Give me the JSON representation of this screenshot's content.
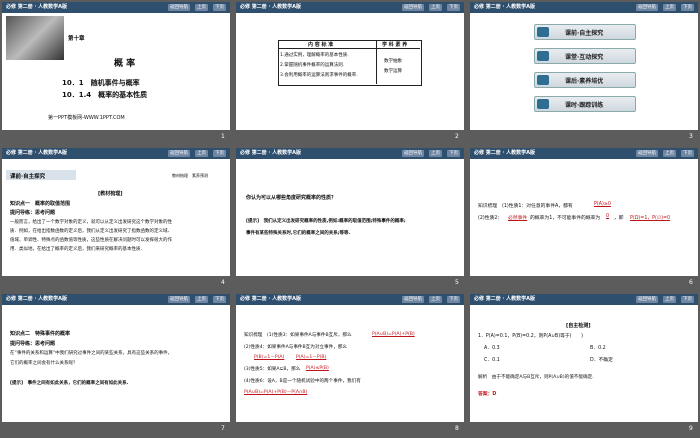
{
  "header": {
    "title": "必修 第二册 · 人教数学A版",
    "btn_nav": "返回导航",
    "btn_prev": "上页",
    "btn_next": "下页"
  },
  "page_numbers": [
    "1",
    "2",
    "3",
    "4",
    "5",
    "6",
    "7",
    "8",
    "9"
  ],
  "slide1": {
    "chapter": "第十章",
    "title": "概 率",
    "sec1": "10．1　随机事件与概率",
    "sec2": "10．1.4　概率的基本性质",
    "source": "第一PPT模板网-WWW.1PPT.COM"
  },
  "slide2": {
    "col1": "内 容 标 准",
    "col2": "学 科 素 养",
    "rows": [
      "1.通过实例，理解概率的基本性质.",
      "2.掌握随机事件概率的运算法则.",
      "3.会利用概率的运算法则求事件的概率."
    ],
    "lit": [
      "数学抽象",
      "数学运算"
    ]
  },
  "slide3": {
    "items": [
      "课前·自主探究",
      "课堂·互动探究",
      "课后·素养培优",
      "课时·跟踪训练"
    ]
  },
  "slide4": {
    "tag": "课前·自主探究",
    "right": "教材梳理　素养预测",
    "h": "[教材梳理]",
    "k1": "知识点一　概率的取值范围",
    "k2": "提问导练：思考问题",
    "p1": "一般而言，给出了一个数学对象的定义，就可以从定义出发研究这个数学对象的性",
    "p2": "质．例如，在给出指数函数的定义后，我们从定义出发研究了指数函数的定义域、",
    "p3": "值域、单调性、特殊点的函数值等性质，这些性质在解决问题时可以发挥很大的作",
    "p4": "用．类似地，在给出了概率的定义后，我们来研究概率的基本性质．"
  },
  "slide5": {
    "q": "你认为可以从哪些角度研究概率的性质？",
    "a1": "[提示]　我们从定义出发研究概率的性质,例如:概率的取值范围;特殊事件的概率;",
    "a2": "事件有某些特殊关系时,它们的概率之间的关系;等等."
  },
  "slide6": {
    "l1": "知识梳理　(1)性质1：对任意的事件A，都有",
    "f1": "P(A)≥0",
    "l2": "(2)性质2：",
    "f2": "必然事件",
    "l2b": "的概率为1，不可能事件的概率为",
    "f3": "0",
    "l2c": "，即",
    "f4": "P(Ω)=1，P(∅)=0"
  },
  "slide7": {
    "k1": "知识点二　特殊事件的概率",
    "k2": "提问导练：思考问题",
    "p1": "在“事件的关系和运算”中我们研究过事件之间的某些关系，具有这些关系的事件，",
    "p2": "它们的概率之间会有什么关系呢？",
    "a": "[提示]　事件之间有如此关系，它们的概率之间有如此关系."
  },
  "slide8": {
    "l1": "知识梳理　(1)性质3：如果事件A与事件B互斥，那么",
    "f1": "P(A∪B)=P(A)+P(B)",
    "l2": "(2)性质4：如果事件A与事件B互为对立事件，那么",
    "f2a": "P(B)=1－P(A)",
    "f2b": "P(A)=1－P(B)",
    "l3": "(3)性质5：如果A⊆B，那么",
    "f3": "P(A)≤P(B)",
    "l4": "(4)性质6：设A，B是一个随机试验中的两个事件，我们有",
    "f4": "P(A∪B)=P(A)+P(B)－P(A∩B)"
  },
  "slide9": {
    "h": "[自主检测]",
    "q": "1．P(A)=0.1，P(B)=0.2，则P(A∪B)等于(　　)",
    "oA": "A．0.3",
    "oB": "B．0.2",
    "oC": "C．0.1",
    "oD": "D．不确定",
    "exp": "解析　由于不能确定A与B互斥，则P(A∪B)的值不能确定.",
    "ans": "答案：D"
  }
}
